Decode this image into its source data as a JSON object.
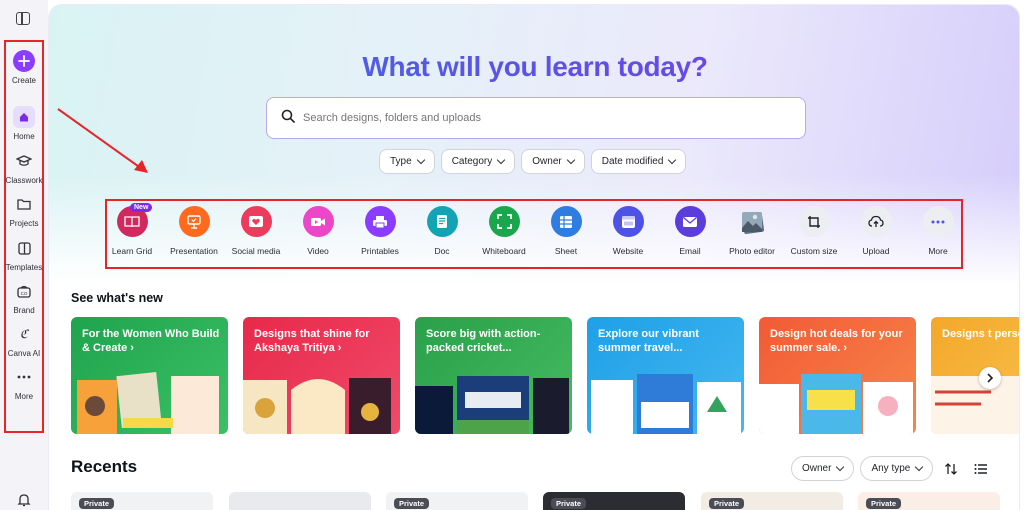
{
  "sidebar": {
    "items": [
      {
        "label": "Create",
        "icon": "plus-icon"
      },
      {
        "label": "Home",
        "icon": "home-icon"
      },
      {
        "label": "Classwork",
        "icon": "graduation-cap-icon"
      },
      {
        "label": "Projects",
        "icon": "folder-icon"
      },
      {
        "label": "Templates",
        "icon": "templates-icon"
      },
      {
        "label": "Brand",
        "icon": "brand-icon"
      },
      {
        "label": "Canva AI",
        "icon": "canva-ai-icon"
      },
      {
        "label": "More",
        "icon": "more-dots-icon"
      }
    ]
  },
  "hero": {
    "title": "What will you learn today?",
    "search_placeholder": "Search designs, folders and uploads"
  },
  "filters": [
    "Type",
    "Category",
    "Owner",
    "Date modified"
  ],
  "design_types": [
    {
      "label": "Learn Grid",
      "color": "#d1295f",
      "badge": "New"
    },
    {
      "label": "Presentation",
      "color": "#ff6a1f"
    },
    {
      "label": "Social media",
      "color": "#ec3b5c"
    },
    {
      "label": "Video",
      "color": "#ee46c8"
    },
    {
      "label": "Printables",
      "color": "#8b3dff"
    },
    {
      "label": "Doc",
      "color": "#13a3b4"
    },
    {
      "label": "Whiteboard",
      "color": "#1aa64d"
    },
    {
      "label": "Sheet",
      "color": "#2f7de1"
    },
    {
      "label": "Website",
      "color": "#4f52e6"
    },
    {
      "label": "Email",
      "color": "#5a3ddb"
    },
    {
      "label": "Photo editor",
      "color": "#7a8590"
    },
    {
      "label": "Custom size",
      "color": "#eceef1"
    },
    {
      "label": "Upload",
      "color": "#eceef1"
    },
    {
      "label": "More",
      "color": "#eceef1"
    }
  ],
  "whats_new": {
    "title": "See what's new",
    "cards": [
      {
        "text": "For the Women Who Build & Create ›",
        "bg": "#1fa44d"
      },
      {
        "text": "Designs that shine for Akshaya Tritiya ›",
        "bg": "#e8294a"
      },
      {
        "text": "Score big with action-packed cricket...",
        "bg": "#2ea34c"
      },
      {
        "text": "Explore our vibrant summer travel...",
        "bg": "#29a5e6"
      },
      {
        "text": "Design hot deals for your summer sale. ›",
        "bg": "#f2603a"
      },
      {
        "text": "Designs t personal",
        "bg": "#f4a72a"
      }
    ]
  },
  "recents": {
    "title": "Recents",
    "owner_label": "Owner",
    "type_label": "Any type",
    "private_badge": "Private"
  }
}
